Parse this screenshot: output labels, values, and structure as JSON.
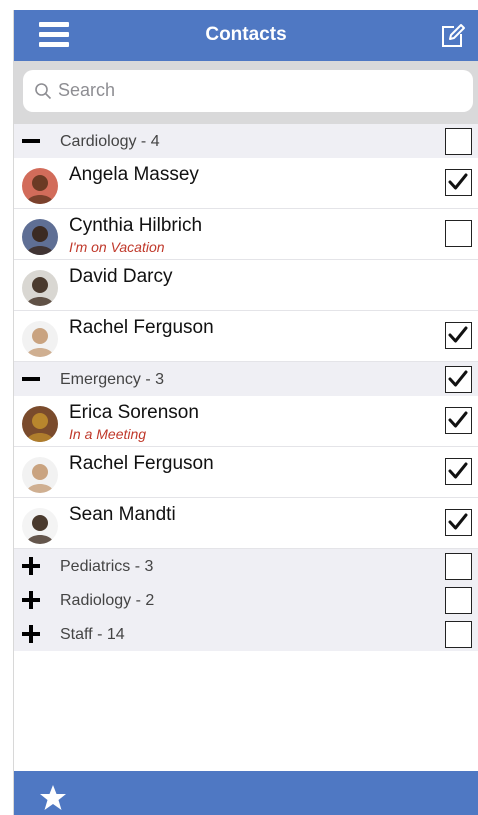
{
  "header": {
    "title": "Contacts",
    "menu_icon": "hamburger-menu-icon",
    "compose_icon": "compose-icon"
  },
  "search": {
    "placeholder": "Search",
    "value": ""
  },
  "colors": {
    "accent": "#4f78c3",
    "status_text": "#c0392b",
    "group_bg": "#efeff4"
  },
  "groups": [
    {
      "label": "Cardiology - 4",
      "expanded": true,
      "checked": false,
      "contacts": [
        {
          "name": "Angela Massey",
          "status": "",
          "checked": true,
          "show_checkbox": true,
          "avatar_colors": [
            "#6b3a24",
            "#d26c5a"
          ]
        },
        {
          "name": "Cynthia Hilbrich",
          "status": "I'm on Vacation",
          "checked": false,
          "show_checkbox": true,
          "avatar_colors": [
            "#3b2a22",
            "#5f6f95"
          ]
        },
        {
          "name": "David Darcy",
          "status": "",
          "checked": false,
          "show_checkbox": false,
          "avatar_colors": [
            "#4a3a2e",
            "#d9d7d2"
          ]
        },
        {
          "name": "Rachel Ferguson",
          "status": "",
          "checked": true,
          "show_checkbox": true,
          "avatar_colors": [
            "#c9a380",
            "#f2f2f2"
          ]
        }
      ]
    },
    {
      "label": "Emergency - 3",
      "expanded": true,
      "checked": true,
      "contacts": [
        {
          "name": "Erica Sorenson",
          "status": "In a Meeting",
          "checked": true,
          "show_checkbox": true,
          "avatar_colors": [
            "#b8862d",
            "#7a4b2c"
          ]
        },
        {
          "name": "Rachel Ferguson",
          "status": "",
          "checked": true,
          "show_checkbox": true,
          "avatar_colors": [
            "#c9a380",
            "#f2f2f2"
          ]
        },
        {
          "name": "Sean Mandti",
          "status": "",
          "checked": true,
          "show_checkbox": true,
          "avatar_colors": [
            "#4a3a2e",
            "#f4f4f4"
          ]
        }
      ]
    },
    {
      "label": "Pediatrics - 3",
      "expanded": false,
      "checked": false,
      "contacts": []
    },
    {
      "label": "Radiology - 2",
      "expanded": false,
      "checked": false,
      "contacts": []
    },
    {
      "label": "Staff - 14",
      "expanded": false,
      "checked": false,
      "contacts": []
    }
  ],
  "footer": {
    "favorite_icon": "star-icon"
  }
}
